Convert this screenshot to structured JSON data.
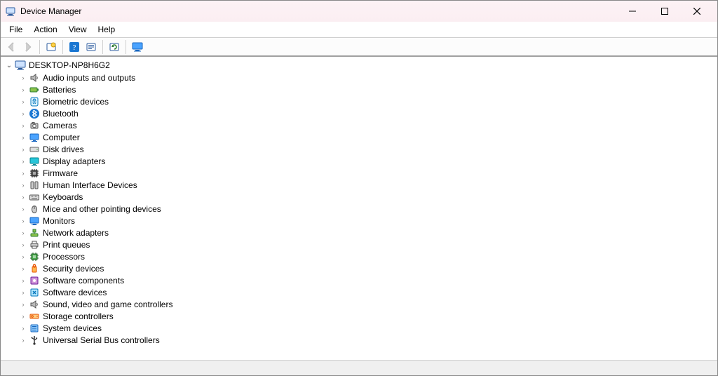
{
  "window": {
    "title": "Device Manager"
  },
  "menubar": {
    "items": [
      "File",
      "Action",
      "View",
      "Help"
    ]
  },
  "toolbar": {
    "buttons": [
      {
        "name": "back-button",
        "icon": "arrow-left",
        "enabled": false
      },
      {
        "name": "forward-button",
        "icon": "arrow-right",
        "enabled": false
      },
      {
        "sep": true
      },
      {
        "name": "show-hidden-button",
        "icon": "box-sun",
        "enabled": true
      },
      {
        "sep": true
      },
      {
        "name": "help-button",
        "icon": "help",
        "enabled": true
      },
      {
        "name": "properties-button",
        "icon": "box-list",
        "enabled": true
      },
      {
        "sep": true
      },
      {
        "name": "scan-button",
        "icon": "box-refresh",
        "enabled": true
      },
      {
        "sep": true
      },
      {
        "name": "add-driver-button",
        "icon": "monitor",
        "enabled": true
      }
    ]
  },
  "tree": {
    "root": {
      "label": "DESKTOP-NP8H6G2",
      "expanded": true,
      "icon": "computer"
    },
    "categories": [
      {
        "label": "Audio inputs and outputs",
        "icon": "speaker"
      },
      {
        "label": "Batteries",
        "icon": "battery"
      },
      {
        "label": "Biometric devices",
        "icon": "fingerprint"
      },
      {
        "label": "Bluetooth",
        "icon": "bluetooth"
      },
      {
        "label": "Cameras",
        "icon": "camera"
      },
      {
        "label": "Computer",
        "icon": "monitor-small"
      },
      {
        "label": "Disk drives",
        "icon": "drive"
      },
      {
        "label": "Display adapters",
        "icon": "display"
      },
      {
        "label": "Firmware",
        "icon": "chip"
      },
      {
        "label": "Human Interface Devices",
        "icon": "hid"
      },
      {
        "label": "Keyboards",
        "icon": "keyboard"
      },
      {
        "label": "Mice and other pointing devices",
        "icon": "mouse"
      },
      {
        "label": "Monitors",
        "icon": "monitor-small"
      },
      {
        "label": "Network adapters",
        "icon": "network"
      },
      {
        "label": "Print queues",
        "icon": "printer"
      },
      {
        "label": "Processors",
        "icon": "cpu"
      },
      {
        "label": "Security devices",
        "icon": "security"
      },
      {
        "label": "Software components",
        "icon": "component"
      },
      {
        "label": "Software devices",
        "icon": "softdev"
      },
      {
        "label": "Sound, video and game controllers",
        "icon": "speaker"
      },
      {
        "label": "Storage controllers",
        "icon": "storage"
      },
      {
        "label": "System devices",
        "icon": "system"
      },
      {
        "label": "Universal Serial Bus controllers",
        "icon": "usb"
      }
    ]
  }
}
